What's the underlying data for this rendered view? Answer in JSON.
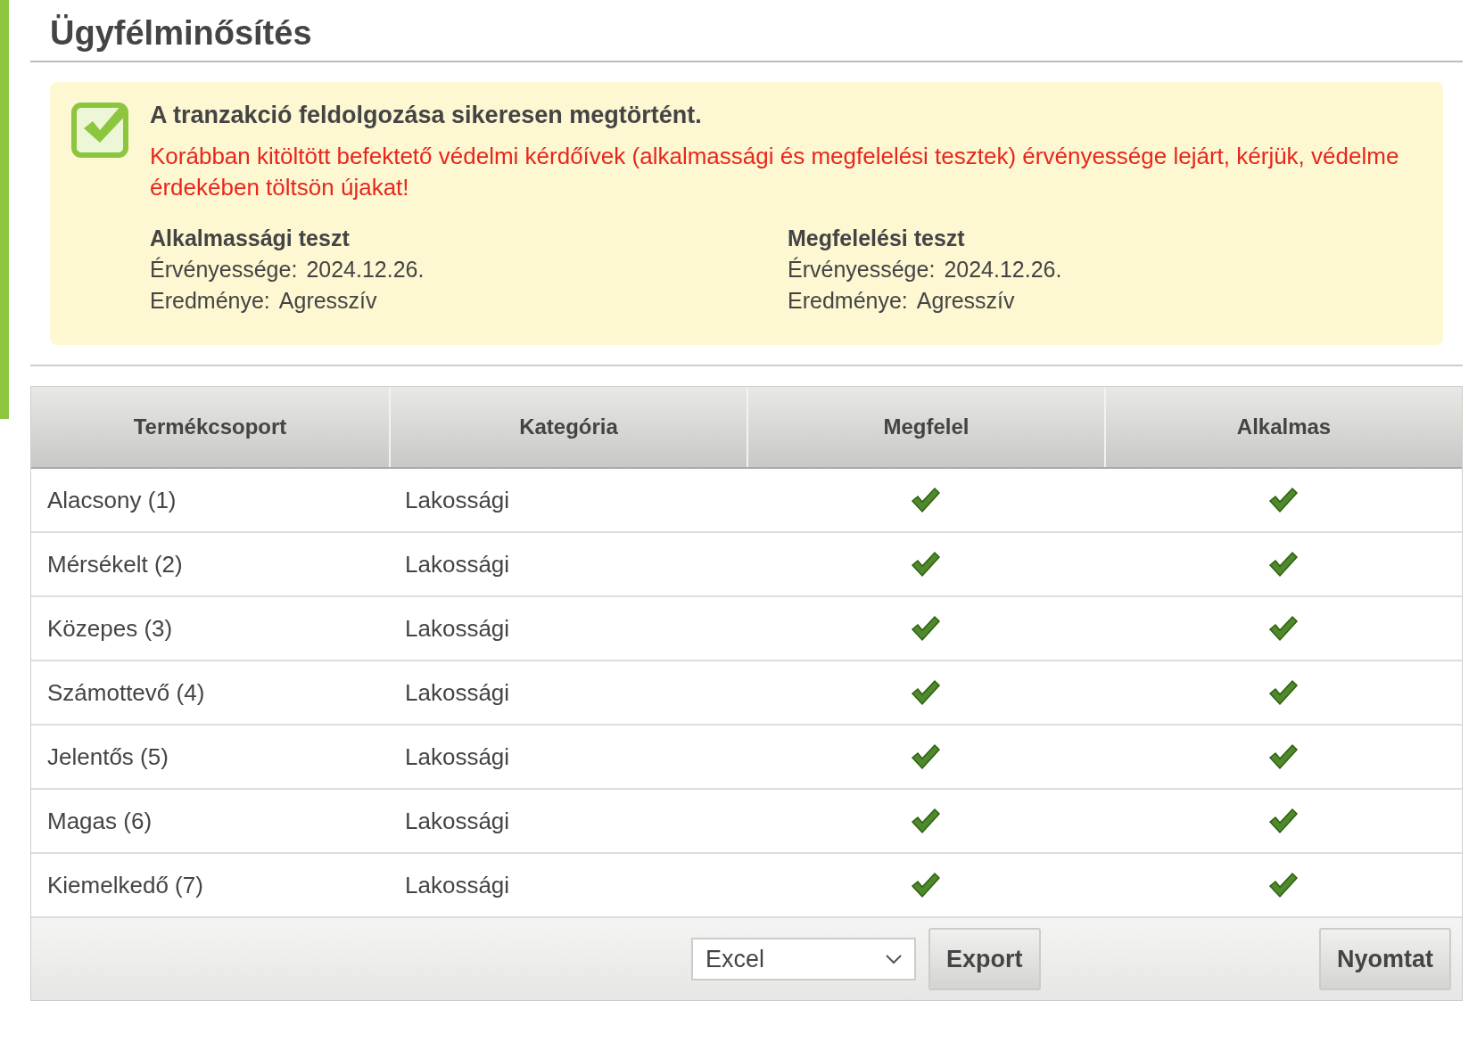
{
  "page": {
    "title": "Ügyfélminősítés"
  },
  "notice": {
    "headline": "A tranzakció feldolgozása sikeresen megtörtént.",
    "warning": "Korábban kitöltött befektető védelmi kérdőívek (alkalmassági és megfelelési tesztek) érvényessége lejárt, kérjük, védelme érdekében töltsön újakat!",
    "tests": [
      {
        "title": "Alkalmassági teszt",
        "validity_label": "Érvényessége:",
        "validity": "2024.12.26.",
        "result_label": "Eredménye:",
        "result": "Agresszív"
      },
      {
        "title": "Megfelelési teszt",
        "validity_label": "Érvényessége:",
        "validity": "2024.12.26.",
        "result_label": "Eredménye:",
        "result": "Agresszív"
      }
    ]
  },
  "table": {
    "columns": [
      "Termékcsoport",
      "Kategória",
      "Megfelel",
      "Alkalmas"
    ],
    "rows": [
      {
        "group": "Alacsony (1)",
        "category": "Lakossági",
        "meets": true,
        "suitable": true
      },
      {
        "group": "Mérsékelt (2)",
        "category": "Lakossági",
        "meets": true,
        "suitable": true
      },
      {
        "group": "Közepes (3)",
        "category": "Lakossági",
        "meets": true,
        "suitable": true
      },
      {
        "group": "Számottevő (4)",
        "category": "Lakossági",
        "meets": true,
        "suitable": true
      },
      {
        "group": "Jelentős (5)",
        "category": "Lakossági",
        "meets": true,
        "suitable": true
      },
      {
        "group": "Magas (6)",
        "category": "Lakossági",
        "meets": true,
        "suitable": true
      },
      {
        "group": "Kiemelkedő (7)",
        "category": "Lakossági",
        "meets": true,
        "suitable": true
      }
    ]
  },
  "footer": {
    "format": {
      "value": "Excel"
    },
    "export_button": "Export",
    "print_button": "Nyomtat"
  }
}
